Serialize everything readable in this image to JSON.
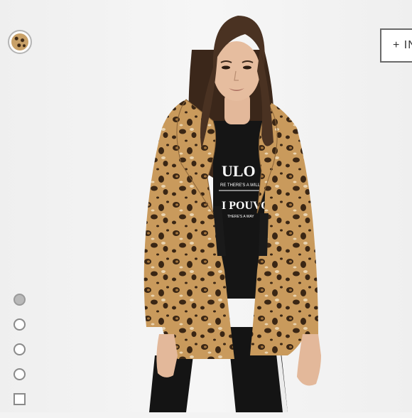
{
  "action_button": {
    "label": "+ IN"
  },
  "swatches": [
    {
      "name": "leopard print"
    }
  ],
  "gallery": {
    "thumbnails": 5,
    "active_index": 0
  },
  "shirt_print": {
    "line1": "ULO",
    "line2": "RE THERE'S A WILL",
    "line3": "I POUVO",
    "line4": "THERE'S A WAY"
  },
  "colors": {
    "coat_base": "#c99a5c",
    "coat_spots": "#3a2614",
    "shirt": "#151515",
    "pants": "#141414",
    "hair": "#4a3222",
    "skin": "#e3b89a",
    "background": "#f3f3f3"
  }
}
